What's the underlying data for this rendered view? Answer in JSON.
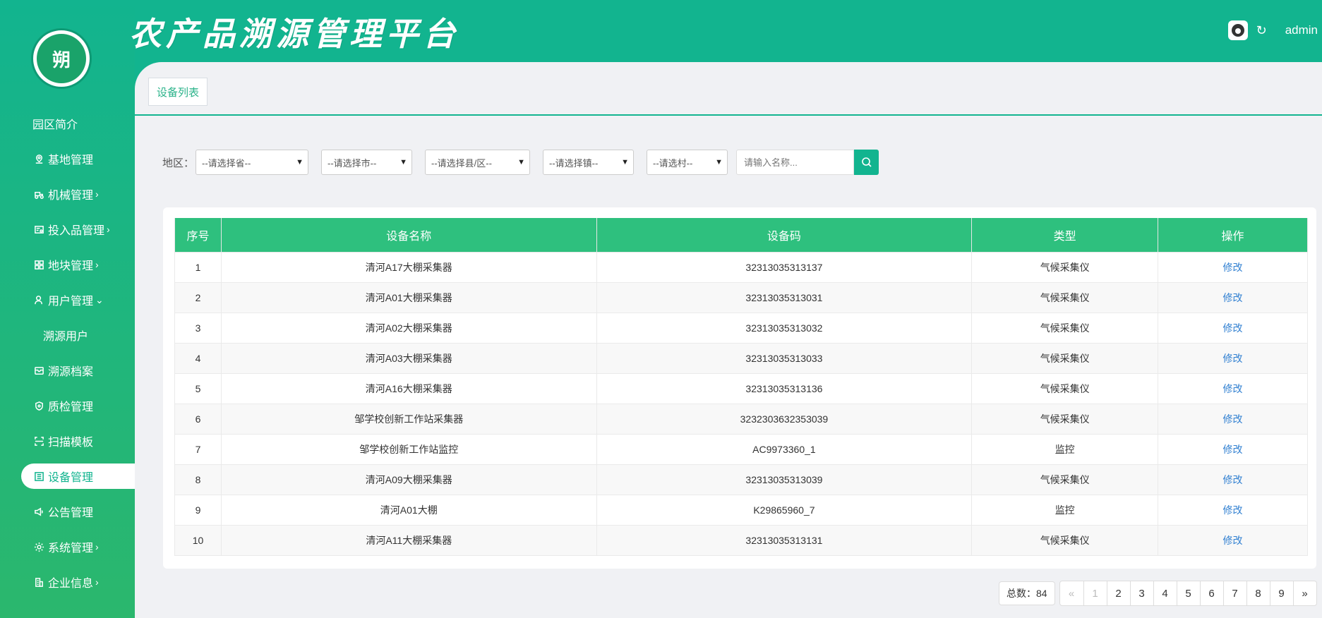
{
  "app": {
    "title": "农产品溯源管理平台",
    "logo_text": "朔",
    "user": "admin"
  },
  "sidebar": {
    "items": [
      {
        "label": "园区简介",
        "icon": "none"
      },
      {
        "label": "基地管理",
        "icon": "location-icon"
      },
      {
        "label": "机械管理",
        "icon": "tractor-icon",
        "chevron": "›"
      },
      {
        "label": "投入品管理",
        "icon": "invoice-icon",
        "chevron": "›"
      },
      {
        "label": "地块管理",
        "icon": "grid-icon",
        "chevron": "›"
      },
      {
        "label": "用户管理",
        "icon": "user-icon",
        "chevron": "⌄"
      },
      {
        "label": "溯源用户",
        "icon": "none"
      },
      {
        "label": "溯源档案",
        "icon": "archive-icon"
      },
      {
        "label": "质检管理",
        "icon": "shield-icon"
      },
      {
        "label": "扫描模板",
        "icon": "scan-icon"
      },
      {
        "label": "设备管理",
        "icon": "device-list-icon"
      },
      {
        "label": "公告管理",
        "icon": "megaphone-icon"
      },
      {
        "label": "系统管理",
        "icon": "gear-icon",
        "chevron": "›"
      },
      {
        "label": "企业信息",
        "icon": "building-icon",
        "chevron": "›"
      }
    ],
    "active": "设备管理"
  },
  "tab": {
    "label": "设备列表"
  },
  "filters": {
    "region_label": "地区：",
    "province": "--请选择省--",
    "city": "--请选择市--",
    "county": "--请选择县/区--",
    "town": "--请选择镇--",
    "village": "--请选村--",
    "search_placeholder": "请输入名称..."
  },
  "table": {
    "headers": [
      "序号",
      "设备名称",
      "设备码",
      "类型",
      "操作"
    ],
    "rows": [
      {
        "no": "1",
        "name": "清河A17大棚采集器",
        "code": "32313035313137",
        "type": "气候采集仪",
        "action": "修改"
      },
      {
        "no": "2",
        "name": "清河A01大棚采集器",
        "code": "32313035313031",
        "type": "气候采集仪",
        "action": "修改"
      },
      {
        "no": "3",
        "name": "清河A02大棚采集器",
        "code": "32313035313032",
        "type": "气候采集仪",
        "action": "修改"
      },
      {
        "no": "4",
        "name": "清河A03大棚采集器",
        "code": "32313035313033",
        "type": "气候采集仪",
        "action": "修改"
      },
      {
        "no": "5",
        "name": "清河A16大棚采集器",
        "code": "32313035313136",
        "type": "气候采集仪",
        "action": "修改"
      },
      {
        "no": "6",
        "name": "邹学校创新工作站采集器",
        "code": "3232303632353039",
        "type": "气候采集仪",
        "action": "修改"
      },
      {
        "no": "7",
        "name": "邹学校创新工作站监控",
        "code": "AC9973360_1",
        "type": "监控",
        "action": "修改"
      },
      {
        "no": "8",
        "name": "清河A09大棚采集器",
        "code": "32313035313039",
        "type": "气候采集仪",
        "action": "修改"
      },
      {
        "no": "9",
        "name": "清河A01大棚",
        "code": "K29865960_7",
        "type": "监控",
        "action": "修改"
      },
      {
        "no": "10",
        "name": "清河A11大棚采集器",
        "code": "32313035313131",
        "type": "气候采集仪",
        "action": "修改"
      }
    ]
  },
  "pagination": {
    "total_label": "总数：84",
    "prev": "«",
    "pages": [
      "1",
      "2",
      "3",
      "4",
      "5",
      "6",
      "7",
      "8",
      "9"
    ],
    "next": "»"
  }
}
